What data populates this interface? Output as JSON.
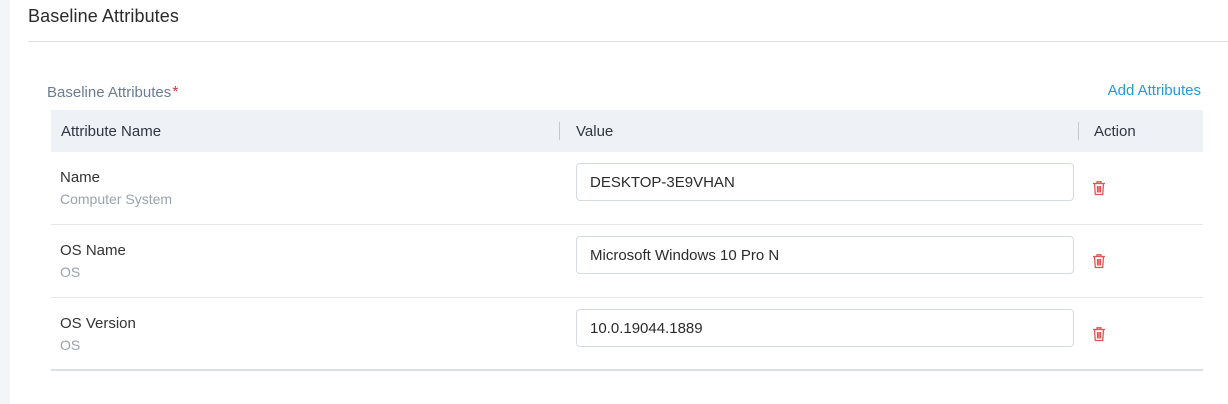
{
  "section": {
    "title": "Baseline Attributes"
  },
  "field": {
    "label": "Baseline Attributes",
    "required_marker": "*",
    "add_link": "Add Attributes"
  },
  "table": {
    "headers": {
      "name": "Attribute Name",
      "value": "Value",
      "action": "Action"
    },
    "rows": [
      {
        "name": "Name",
        "category": "Computer System",
        "value": "DESKTOP-3E9VHAN",
        "action_icon": "trash-icon"
      },
      {
        "name": "OS Name",
        "category": "OS",
        "value": "Microsoft Windows 10 Pro N",
        "action_icon": "trash-icon"
      },
      {
        "name": "OS Version",
        "category": "OS",
        "value": "10.0.19044.1889",
        "action_icon": "trash-icon"
      }
    ]
  },
  "colors": {
    "accent": "#1a9fd6",
    "danger": "#e0554f",
    "required": "#d9363e"
  }
}
